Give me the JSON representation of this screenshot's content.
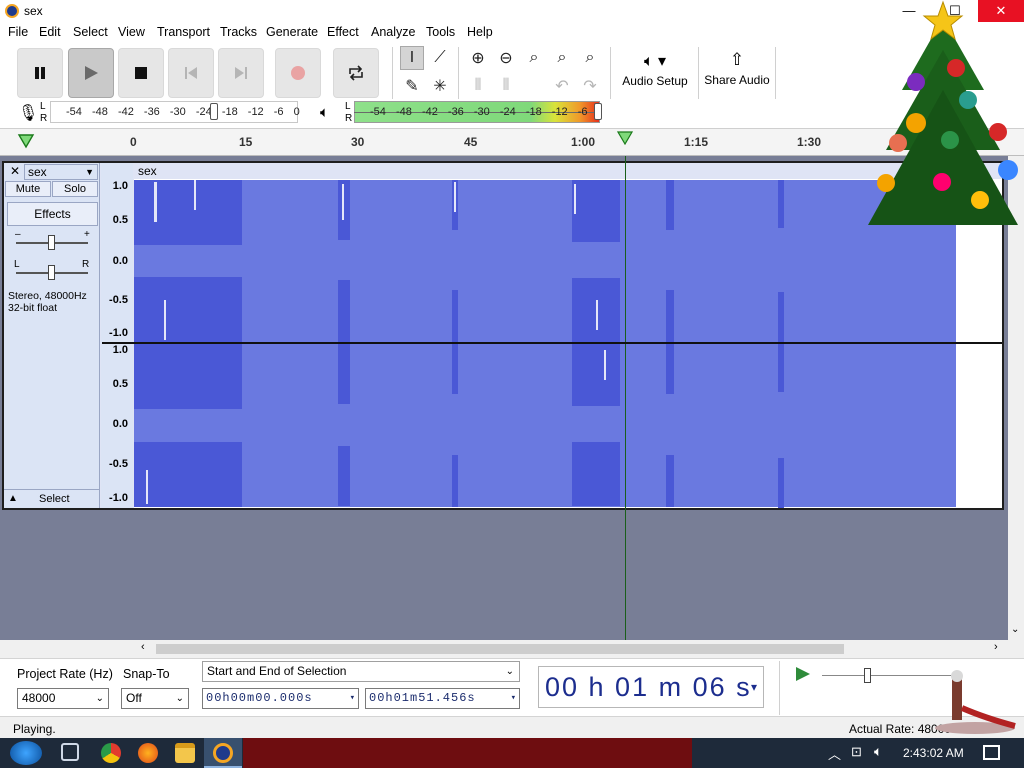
{
  "window": {
    "title": "sex",
    "min": "—",
    "max": "☐",
    "close": "✕"
  },
  "menu": [
    "File",
    "Edit",
    "Select",
    "View",
    "Transport",
    "Tracks",
    "Generate",
    "Effect",
    "Analyze",
    "Tools",
    "Help"
  ],
  "toolbar": {
    "audio_setup": "Audio Setup",
    "share_audio": "Share Audio",
    "rec_meter_ticks": [
      "-54",
      "-48",
      "-42",
      "-36",
      "-30",
      "-24",
      "-18",
      "-12",
      "-6",
      "0"
    ],
    "play_meter_ticks": [
      "-54",
      "-48",
      "-42",
      "-36",
      "-30",
      "-24",
      "-18",
      "-12",
      "-6"
    ],
    "lr": [
      "L",
      "R"
    ]
  },
  "timeline": {
    "ticks": [
      "0",
      "15",
      "30",
      "45",
      "1:00",
      "1:15",
      "1:30"
    ]
  },
  "track": {
    "name": "sex",
    "mute": "Mute",
    "solo": "Solo",
    "effects": "Effects",
    "gain_minus": "–",
    "gain_plus": "+",
    "pan_l": "L",
    "pan_r": "R",
    "info_line1": "Stereo, 48000Hz",
    "info_line2": "32-bit float",
    "select": "Select",
    "clip_name": "sex",
    "ruler_top": [
      "1.0",
      "0.5",
      "0.0",
      "-0.5",
      "-1.0"
    ],
    "ruler_bottom": [
      "1.0",
      "0.5",
      "0.0",
      "-0.5",
      "-1.0"
    ]
  },
  "selection": {
    "project_rate_label": "Project Rate (Hz)",
    "project_rate": "48000",
    "snap_label": "Snap-To",
    "snap": "Off",
    "mode": "Start and End of Selection",
    "start": "00h00m00.000s",
    "end": "00h01m51.456s",
    "clock": "00 h 01 m 06 s"
  },
  "status": {
    "text": "Playing.",
    "rate": "Actual Rate: 48000"
  },
  "taskbar": {
    "time": "2:43:02 AM"
  },
  "colors": {
    "waveform": "#6a79e0",
    "waveform_peak": "#3845c4",
    "track_bg": "#dbe4f5",
    "clock_text": "#1c2d8e"
  }
}
